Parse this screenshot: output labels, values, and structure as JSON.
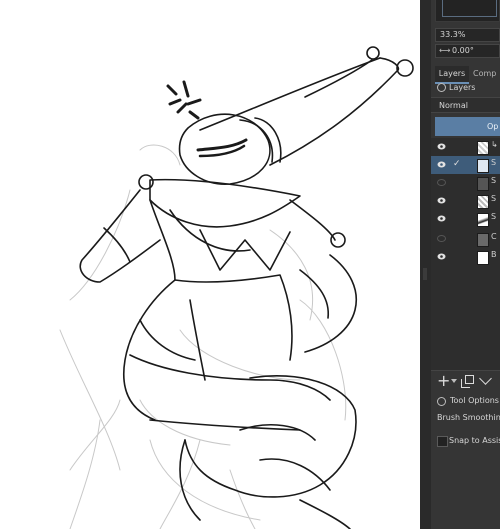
{
  "canvas": {
    "artwork": "lineart-sketch",
    "icons": [
      "anger-symbol"
    ]
  },
  "panel": {
    "zoom_value": "33.3%",
    "rotation_value": "0.00°",
    "tabs": [
      {
        "label": "Layers",
        "active": true
      },
      {
        "label": "Comp",
        "active": false
      }
    ],
    "layers_title": "Layers",
    "blend_mode": "Normal",
    "opacity_label": "Op",
    "layers": [
      {
        "visible": true,
        "selected": false,
        "checked": false,
        "tag": "↳"
      },
      {
        "visible": true,
        "selected": true,
        "checked": true,
        "tag": "S"
      },
      {
        "visible": false,
        "selected": false,
        "checked": false,
        "tag": "S"
      },
      {
        "visible": true,
        "selected": false,
        "checked": false,
        "tag": "S"
      },
      {
        "visible": true,
        "selected": false,
        "checked": false,
        "tag": "S"
      },
      {
        "visible": false,
        "selected": false,
        "checked": false,
        "tag": "C"
      },
      {
        "visible": true,
        "selected": false,
        "checked": false,
        "tag": "B"
      }
    ],
    "add_symbol": "+",
    "tool_options_label": "Tool Options",
    "brush_smoothing_label": "Brush Smoothing:",
    "snap_label": "Snap to Assista"
  },
  "colors": {
    "panel_bg": "#353535",
    "accent": "#5a7ea4",
    "selection": "#3e5c7a",
    "canvas_bg": "#ffffff"
  }
}
